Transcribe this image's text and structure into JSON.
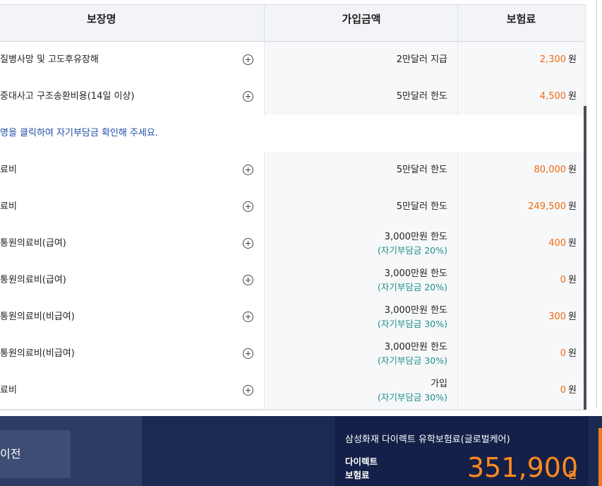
{
  "table": {
    "headers": {
      "name": "보장명",
      "amount": "가입금액",
      "premium": "보험료"
    },
    "premium_unit": "원",
    "rows_top": [
      {
        "name": "질병사망 및 고도후유장해",
        "amount": "2만달러 지급",
        "premium": "2,300"
      },
      {
        "name": "중대사고 구조송환비용(14일 이상)",
        "amount": "5만달러 한도",
        "premium": "4,500"
      }
    ],
    "notice": "명을 클릭하여 자기부담금 확인해 주세요.",
    "rows_bottom": [
      {
        "name": "료비",
        "amount": "5만달러 한도",
        "premium": "80,000"
      },
      {
        "name": "료비",
        "amount": "5만달러 한도",
        "premium": "249,500"
      },
      {
        "name": "통원의료비(급여)",
        "amount": "3,000만원 한도",
        "amount_sub": "(자기부담금 20%)",
        "premium": "400"
      },
      {
        "name": "통원의료비(급여)",
        "amount": "3,000만원 한도",
        "amount_sub": "(자기부담금 20%)",
        "premium": "0"
      },
      {
        "name": "통원의료비(비급여)",
        "amount": "3,000만원 한도",
        "amount_sub": "(자기부담금 30%)",
        "premium": "300"
      },
      {
        "name": "통원의료비(비급여)",
        "amount": "3,000만원 한도",
        "amount_sub": "(자기부담금 30%)",
        "premium": "0"
      },
      {
        "name": "료비",
        "amount": "가입",
        "amount_sub": "(자기부담금 30%)",
        "premium": "0"
      }
    ]
  },
  "footer": {
    "prev_label": "이전",
    "product_name": "삼성화재 다이렉트 유학보험료(글로벌케어)",
    "direct_label": "다이렉트 보험료",
    "total": "351,900",
    "total_unit": "원"
  },
  "colors": {
    "premium": "#f06a10",
    "sub_note": "#1e8f86",
    "notice": "#1f4fa5",
    "footer_bg": "#1b2a52",
    "total": "#ff8a1e"
  },
  "icons": {
    "expand": "plus-circle-icon"
  }
}
